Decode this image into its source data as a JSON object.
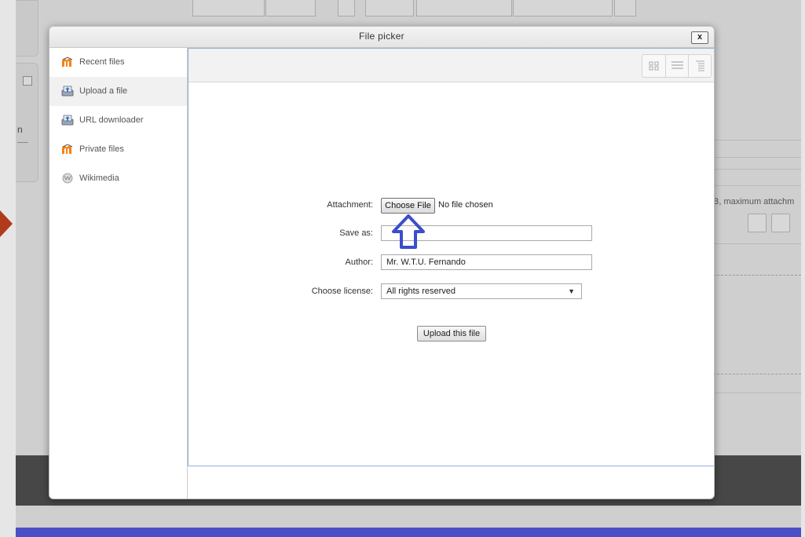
{
  "dialog": {
    "title": "File picker",
    "close_label": "x"
  },
  "sidebar": {
    "items": [
      {
        "label": "Recent files",
        "icon": "moodle-icon",
        "active": false
      },
      {
        "label": "Upload a file",
        "icon": "upload-icon",
        "active": true
      },
      {
        "label": "URL downloader",
        "icon": "url-download-icon",
        "active": false
      },
      {
        "label": "Private files",
        "icon": "moodle-icon",
        "active": false
      },
      {
        "label": "Wikimedia",
        "icon": "wikimedia-icon",
        "active": false
      }
    ]
  },
  "view_buttons": [
    "icons-view-icon",
    "list-view-icon",
    "tree-view-icon"
  ],
  "form": {
    "attachment_label": "Attachment:",
    "choose_file_label": "Choose File",
    "no_file_text": "No file chosen",
    "save_as_label": "Save as:",
    "save_as_value": "",
    "author_label": "Author:",
    "author_value": "Mr. W.T.U. Fernando",
    "license_label": "Choose license:",
    "license_value": "All rights reserved",
    "upload_button": "Upload this file"
  },
  "background": {
    "left_text": "n",
    "right_text": "B, maximum attachm"
  },
  "colors": {
    "accent_blue": "#3a4ecc",
    "inner_border": "#8db1d6",
    "moodle_orange": "#f98012",
    "pointer_red": "#b1391c"
  }
}
